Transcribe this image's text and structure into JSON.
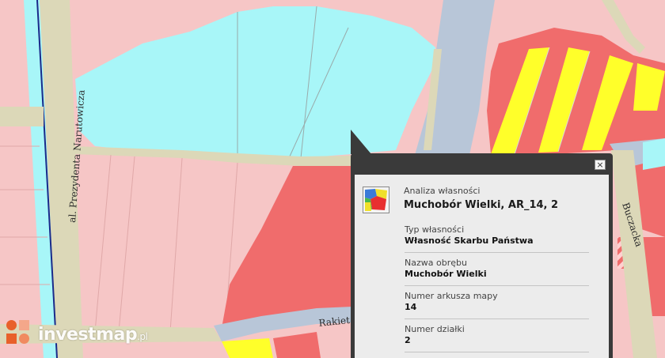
{
  "map": {
    "streets": {
      "narutowicza": "al. Prezydenta Narutowicza",
      "rakietowa": "Rakiet",
      "buczacka": "Buczacka"
    },
    "colors": {
      "pink": "#f6c6c6",
      "cyan": "#a8f6f8",
      "red": "#f06c6c",
      "yellow": "#ffff2a",
      "road": "#dcd8b8",
      "bluegray": "#b8c6d8",
      "darkblue": "#1a2a8a"
    }
  },
  "popup": {
    "close_label": "×",
    "layer_icon": "ownership-analysis-icon",
    "layer_name": "Analiza własności",
    "title": "Muchobór Wielki, AR_14, 2",
    "fields": [
      {
        "label": "Typ własności",
        "value": "Własność Skarbu Państwa"
      },
      {
        "label": "Nazwa obrębu",
        "value": "Muchobór Wielki"
      },
      {
        "label": "Numer arkusza mapy",
        "value": "14"
      },
      {
        "label": "Numer działki",
        "value": "2"
      }
    ]
  },
  "watermark": {
    "text": "investmap",
    "tld": ".pl",
    "logo_colors": [
      "#e8602a",
      "#f4a78a",
      "#e8602a",
      "#f08a60"
    ]
  }
}
